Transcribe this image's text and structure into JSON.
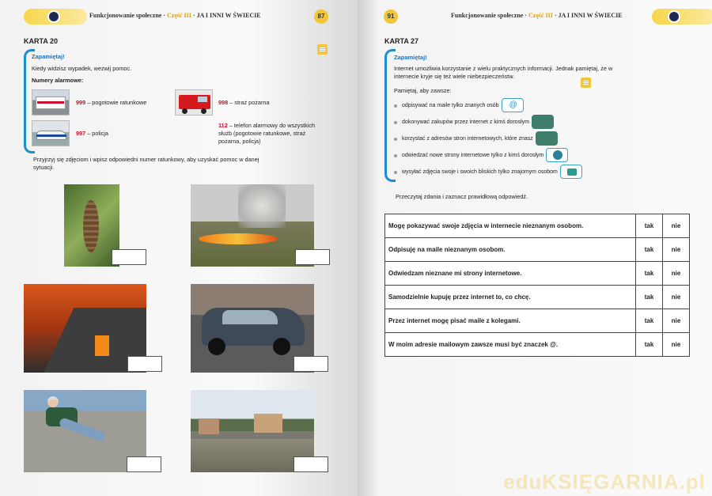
{
  "left_page": {
    "header": {
      "title": "Funkcjonowanie społeczne",
      "part": "Część III",
      "section": "JA I INNI W ŚWIECIE"
    },
    "page_number": "87",
    "card_title": "KARTA 20",
    "remember": {
      "label": "Zapamiętaj!",
      "intro": "Kiedy widzisz wypadek, wezwij pomoc.",
      "numbers_label": "Numery alarmowe",
      "numbers_colon": ":",
      "items": [
        {
          "number": "999",
          "text": " – pogotowie ratunkowe"
        },
        {
          "number": "998",
          "text": " – straż pożarna"
        },
        {
          "number": "997",
          "text": " – policja"
        },
        {
          "number": "112",
          "text": " – telefon alarmowy do wszystkich służb (pogotowie ratunkowe, straż pożarna, policja)"
        }
      ]
    },
    "instruction": "Przyjrzyj się zdjęciom i wpisz odpowiedni numer ratunkowy, aby uzyskać pomoc w danej sytuacji."
  },
  "right_page": {
    "header": {
      "title": "Funkcjonowanie społeczne",
      "part": "Część III",
      "section": "JA I INNI W ŚWIECIE"
    },
    "page_number": "91",
    "card_title": "KARTA 27",
    "remember": {
      "label": "Zapamiętaj!",
      "intro": "Internet umożliwia korzystanie z wielu praktycznych informacji. Jednak pamiętaj, że w internecie kryje się też wiele niebezpieczeństw.",
      "always_label": "Pamiętaj, aby zawsze:",
      "bullets": [
        {
          "text": "odpisywać na maile tylko znanych osób",
          "icon": "email-icon"
        },
        {
          "text": "dokonywać zakupów przez internet z kimś dorosłym",
          "icon": "cart-icon"
        },
        {
          "text": "korzystać z adresów stron internetowych, które znasz",
          "icon": "web-icon"
        },
        {
          "text": "odwiedzać nowe strony internetowe tylko z kimś dorosłym",
          "icon": "user-icon"
        },
        {
          "text": "wysyłać zdjęcia swoje i swoich bliskich tylko znajomym osobom",
          "icon": "camera-icon"
        }
      ]
    },
    "instruction": "Przeczytaj zdania i zaznacz prawidłową odpowiedź.",
    "questions": [
      {
        "text": "Mogę pokazywać swoje zdjęcia w internecie nieznanym osobom.",
        "yes": "tak",
        "no": "nie"
      },
      {
        "text": "Odpisuję na maile nieznanym osobom.",
        "yes": "tak",
        "no": "nie"
      },
      {
        "text": "Odwiedzam nieznane mi strony internetowe.",
        "yes": "tak",
        "no": "nie"
      },
      {
        "text": "Samodzielnie kupuję przez internet to, co chcę.",
        "yes": "tak",
        "no": "nie"
      },
      {
        "text": "Przez internet mogę pisać maile z kolegami.",
        "yes": "tak",
        "no": "nie"
      },
      {
        "text": "W moim adresie mailowym zawsze musi być znaczek @.",
        "yes": "tak",
        "no": "nie"
      }
    ]
  },
  "watermark": "eduKSIĘGARNIA.pl"
}
